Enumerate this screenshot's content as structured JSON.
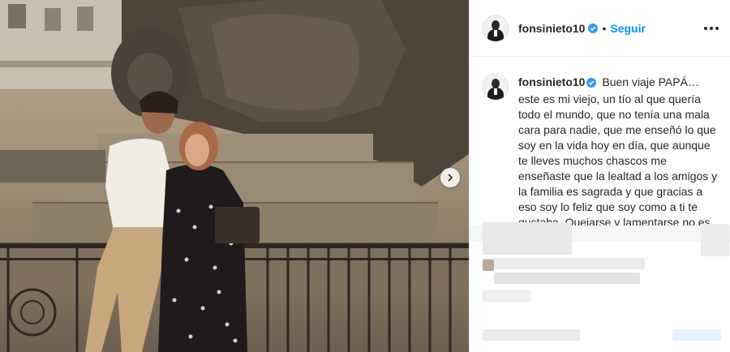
{
  "post": {
    "username": "fonsinieto10",
    "follow_label": "Seguir",
    "dot": "•",
    "caption_text": "Buen viaje PAPÁ… este es mi viejo, un tío al que quería todo el mundo, que no tenía una mala cara para nadie, que me enseñó lo que soy en la vida hoy en día, que aunque te lleves muchos chascos me enseñaste que la lealtad a los amigos y la familia es sagrada y que gracias a eso soy lo feliz que soy como a ti te gustaba. Quejarse y lamentarse no es lo que nos"
  },
  "colors": {
    "accent": "#0095f6",
    "verified": "#3897f0",
    "text": "#262626"
  },
  "icons": {
    "verified": "verified-badge-icon",
    "more": "more-options-icon",
    "next": "chevron-right-icon"
  }
}
